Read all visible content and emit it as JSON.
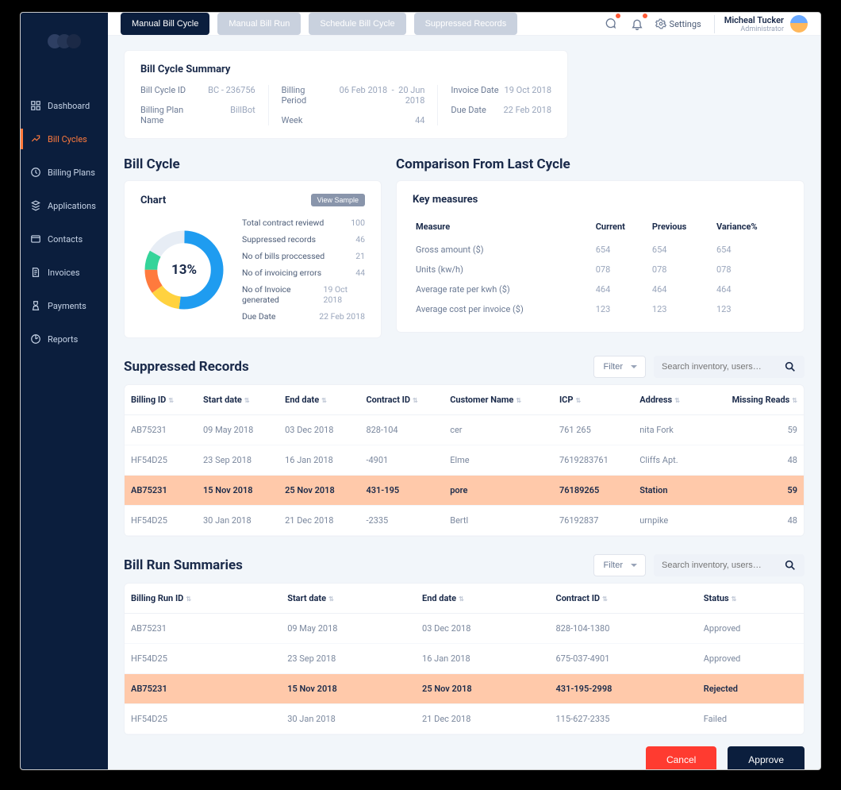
{
  "brand_colors": {
    "dots": [
      "#2e3f63",
      "#253555",
      "#1b2946"
    ]
  },
  "sidebar": {
    "items": [
      {
        "label": "Dashboard"
      },
      {
        "label": "Bill Cycles"
      },
      {
        "label": "Billing Plans"
      },
      {
        "label": "Applications"
      },
      {
        "label": "Contacts"
      },
      {
        "label": "Invoices"
      },
      {
        "label": "Payments"
      },
      {
        "label": "Reports"
      }
    ]
  },
  "topbar": {
    "tabs": [
      {
        "label": "Manual Bill Cycle",
        "active": true
      },
      {
        "label": "Manual Bill Run"
      },
      {
        "label": "Schedule Bill Cycle"
      },
      {
        "label": "Suppressed Records"
      }
    ],
    "settings_label": "Settings",
    "user": {
      "name": "Micheal Tucker",
      "role": "Administrator"
    }
  },
  "summary": {
    "title": "Bill Cycle Summary",
    "bill_cycle_id_label": "Bill Cycle ID",
    "bill_cycle_id": "BC - 236756",
    "billing_plan_name_label": "Billing Plan Name",
    "billing_plan_name": "BillBot",
    "billing_period_label": "Billing Period",
    "billing_period_from": "06 Feb 2018",
    "billing_period_sep": "-",
    "billing_period_to": "20 Jun 2018",
    "week_label": "Week",
    "week": "44",
    "invoice_date_label": "Invoice Date",
    "invoice_date": "19 Oct 2018",
    "due_date_label": "Due Date",
    "due_date": "22 Feb 2018"
  },
  "bill_cycle": {
    "section": "Bill Cycle",
    "chart_title": "Chart",
    "view_sample": "View Sample",
    "donut_center": "13%",
    "rows": [
      {
        "k": "Total contract reviewd",
        "v": "100"
      },
      {
        "k": "Suppressed records",
        "v": "46"
      },
      {
        "k": "No of bills proccessed",
        "v": "21"
      },
      {
        "k": "No of invoicing errors",
        "v": "44"
      },
      {
        "k": "No of Invoice generated",
        "v": "19 Oct 2018"
      },
      {
        "k": "Due Date",
        "v": "22 Feb 2018"
      }
    ]
  },
  "comparison": {
    "section": "Comparison From Last Cycle",
    "card_title": "Key measures",
    "headers": {
      "measure": "Measure",
      "current": "Current",
      "previous": "Previous",
      "variance": "Variance%"
    },
    "rows": [
      {
        "measure": "Gross amount ($)",
        "current": "654",
        "previous": "654",
        "variance": "654"
      },
      {
        "measure": "Units (kw/h)",
        "current": "078",
        "previous": "078",
        "variance": "078"
      },
      {
        "measure": "Average rate per kwh ($)",
        "current": "464",
        "previous": "464",
        "variance": "464"
      },
      {
        "measure": "Average cost per invoice ($)",
        "current": "123",
        "previous": "123",
        "variance": "123"
      }
    ]
  },
  "suppressed": {
    "title": "Suppressed Records",
    "filter_label": "Filter",
    "search_placeholder": "Search inventory, users…",
    "headers": [
      "Billing ID",
      "Start date",
      "End date",
      "Contract ID",
      "Customer Name",
      "ICP",
      "Address",
      "Missing Reads"
    ],
    "rows": [
      {
        "hl": false,
        "cells": [
          "AB75231",
          "09 May 2018",
          "03 Dec 2018",
          "828-104",
          "cer",
          "761             265",
          "nita Fork",
          "59"
        ]
      },
      {
        "hl": false,
        "cells": [
          "HF54D25",
          "23 Sep 2018",
          "16 Jan 2018",
          "-4901",
          "Elme",
          "7619283761",
          "Cliffs Apt.",
          "48"
        ]
      },
      {
        "hl": true,
        "cells": [
          "AB75231",
          "15 Nov 2018",
          "25 Nov 2018",
          "431-195",
          "pore",
          "76189265",
          "Station",
          "59"
        ]
      },
      {
        "hl": false,
        "cells": [
          "HF54D25",
          "30 Jan 2018",
          "21 Dec 2018",
          "-2335",
          "Bertl",
          "76192837",
          "urnpike",
          "48"
        ]
      }
    ]
  },
  "bill_runs": {
    "title": "Bill Run Summaries",
    "filter_label": "Filter",
    "search_placeholder": "Search inventory, users…",
    "headers": [
      "Billing Run ID",
      "Start date",
      "End date",
      "Contract ID",
      "Status"
    ],
    "rows": [
      {
        "hl": false,
        "cells": [
          "AB75231",
          "09 May 2018",
          "03 Dec 2018",
          "828-104-1380",
          "Approved"
        ]
      },
      {
        "hl": false,
        "cells": [
          "HF54D25",
          "23 Sep 2018",
          "16 Jan 2018",
          "675-037-4901",
          "Approved"
        ]
      },
      {
        "hl": true,
        "cells": [
          "AB75231",
          "15 Nov 2018",
          "25 Nov 2018",
          "431-195-2998",
          "Rejected"
        ]
      },
      {
        "hl": false,
        "cells": [
          "HF54D25",
          "30 Jan 2018",
          "21 Dec 2018",
          "115-627-2335",
          "Failed"
        ]
      }
    ]
  },
  "actions": {
    "cancel": "Cancel",
    "approve": "Approve"
  },
  "chart_data": {
    "type": "pie",
    "title": "",
    "series": [
      {
        "name": "Segment 1",
        "value": 52,
        "color": "#1f9cf0"
      },
      {
        "name": "Segment 2",
        "value": 13,
        "color": "#ffd23f"
      },
      {
        "name": "Segment 3",
        "value": 10,
        "color": "#ff7a3d"
      },
      {
        "name": "Segment 4",
        "value": 8,
        "color": "#34d49a"
      },
      {
        "name": "Remainder",
        "value": 17,
        "color": "#e7edf5"
      }
    ],
    "center_label": "13%"
  }
}
